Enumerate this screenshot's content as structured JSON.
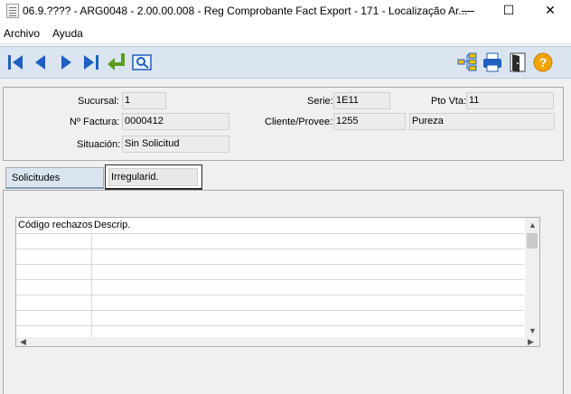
{
  "window": {
    "title": "06.9.???? - ARG0048 - 2.00.00.008 - Reg Comprobante Fact Export - 171 - Localização Ar...",
    "minimize": "—",
    "maximize": "☐",
    "close": "✕"
  },
  "menu": {
    "items": [
      "Archivo",
      "Ayuda"
    ]
  },
  "toolbar": {
    "left": [
      "first-record-icon",
      "previous-record-icon",
      "next-record-icon",
      "last-record-icon",
      "return-arrow-icon",
      "search-icon"
    ],
    "right": [
      "tree-structure-icon",
      "printer-icon",
      "exit-door-icon",
      "help-icon"
    ],
    "help_glyph": "?",
    "colors": {
      "nav": "#1f5fbf",
      "return": "#5a9e1b",
      "help": "#f5a300"
    }
  },
  "form": {
    "sucursal": {
      "label": "Sucursal:",
      "value": "1"
    },
    "serie": {
      "label": "Serie:",
      "value": "1E11"
    },
    "pto_vta": {
      "label": "Pto Vta:",
      "value": "11"
    },
    "nro_factura": {
      "label": "Nº Factura:",
      "value": "0000412"
    },
    "cliente": {
      "label": "Cliente/Provee:",
      "value": "1255",
      "name": "Pureza"
    },
    "situacion": {
      "label": "Situación:",
      "value": "Sin Solicitud"
    }
  },
  "tabs": [
    {
      "label": "Solicitudes",
      "active": false
    },
    {
      "label": "Irregularid.",
      "active": true
    }
  ],
  "grid": {
    "columns": [
      "Código rechazos",
      "Descrip."
    ],
    "rows": []
  }
}
